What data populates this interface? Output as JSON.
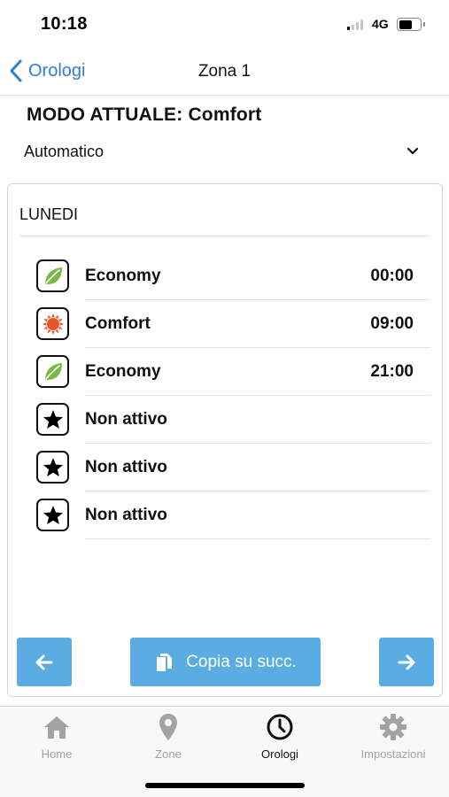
{
  "status_bar": {
    "time": "10:18",
    "network": "4G",
    "battery_level": 0.62
  },
  "nav": {
    "back_label": "Orologi",
    "title": "Zona 1"
  },
  "mode": {
    "title": "MODO ATTUALE: Comfort",
    "selected": "Automatico"
  },
  "schedule": {
    "day": "LUNEDI",
    "rows": [
      {
        "icon": "leaf-icon",
        "label": "Economy",
        "time": "00:00"
      },
      {
        "icon": "sun-icon",
        "label": "Comfort",
        "time": "09:00"
      },
      {
        "icon": "leaf-icon",
        "label": "Economy",
        "time": "21:00"
      },
      {
        "icon": "star-icon",
        "label": "Non attivo",
        "time": ""
      },
      {
        "icon": "star-icon",
        "label": "Non attivo",
        "time": ""
      },
      {
        "icon": "star-icon",
        "label": "Non attivo",
        "time": ""
      }
    ]
  },
  "actions": {
    "copy_label": "Copia su succ.",
    "prev_icon": "arrow-left-icon",
    "next_icon": "arrow-right-icon"
  },
  "tabs": [
    {
      "label": "Home",
      "icon": "home-icon",
      "active": false
    },
    {
      "label": "Zone",
      "icon": "map-pin-icon",
      "active": false
    },
    {
      "label": "Orologi",
      "icon": "clock-icon",
      "active": true
    },
    {
      "label": "Impostazioni",
      "icon": "gear-icon",
      "active": false
    }
  ],
  "colors": {
    "accent": "#2f7ed8",
    "button": "#5aace2",
    "leaf": "#7bb84a",
    "sun": "#e5552b",
    "tab_inactive": "#a3a3a3"
  }
}
